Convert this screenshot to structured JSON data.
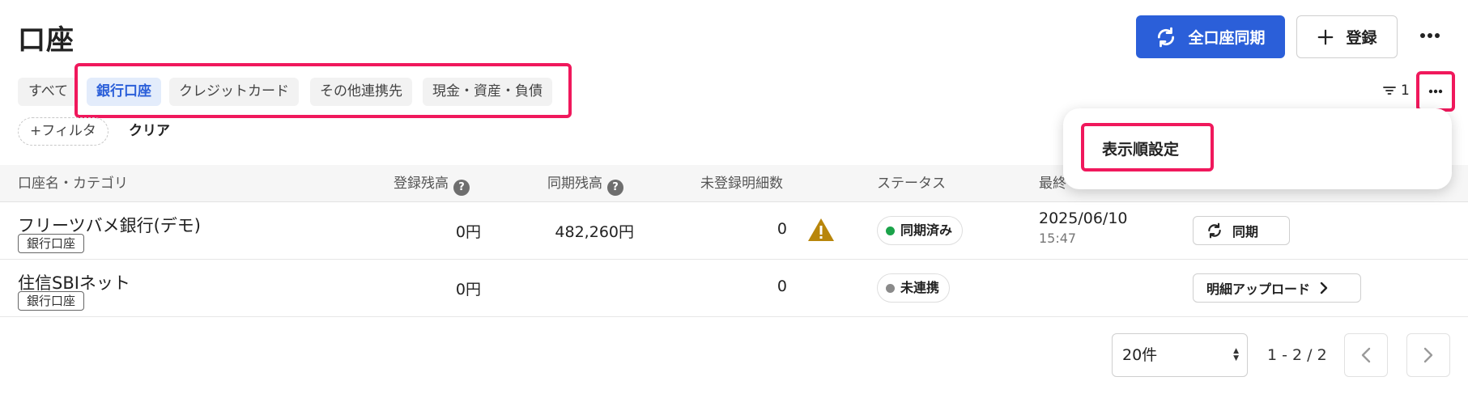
{
  "page": {
    "title": "口座"
  },
  "header": {
    "sync_all_label": "全口座同期",
    "register_label": "登録"
  },
  "tabs": {
    "all": "すべて",
    "items": [
      "銀行口座",
      "クレジットカード",
      "その他連携先",
      "現金・資産・負債"
    ],
    "active_index": 0
  },
  "filters": {
    "add_label": "+フィルタ",
    "clear_label": "クリア",
    "count": "1"
  },
  "menu": {
    "items": [
      "表示順設定"
    ]
  },
  "table": {
    "columns": [
      "口座名・カテゴリ",
      "登録残高",
      "同期残高",
      "未登録明細数",
      "ステータス",
      "最終"
    ],
    "rows": [
      {
        "name": "フリーツバメ銀行(デモ)",
        "category": "銀行口座",
        "registered_balance": "0円",
        "synced_balance": "482,260円",
        "unregistered_count": "0",
        "warning": true,
        "status": "同期済み",
        "status_color": "#1ba34a",
        "last_date": "2025/06/10",
        "last_time": "15:47",
        "action": "同期"
      },
      {
        "name": "住信SBIネット",
        "category": "銀行口座",
        "registered_balance": "0円",
        "synced_balance": "",
        "unregistered_count": "0",
        "warning": false,
        "status": "未連携",
        "status_color": "#8a8a8a",
        "last_date": "",
        "last_time": "",
        "action": "明細アップロード"
      }
    ]
  },
  "pagination": {
    "page_size": "20件",
    "range": "1 - 2 / 2"
  },
  "colors": {
    "accent": "#2b5fd9",
    "highlight": "#f0185c",
    "warning": "#b8860b"
  }
}
